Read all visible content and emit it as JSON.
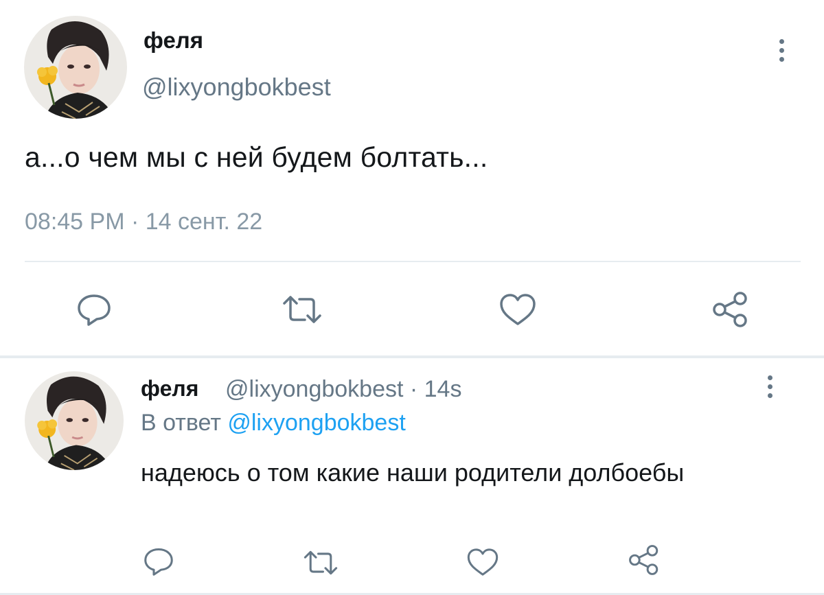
{
  "main_tweet": {
    "display_name": "феля",
    "handle": "@lixyongbokbest",
    "text": "а...о чем мы с ней будем болтать...",
    "timestamp": "08:45 PM · 14 сент. 22",
    "actions": [
      "reply-icon",
      "retweet-icon",
      "like-icon",
      "share-icon"
    ]
  },
  "reply_tweet": {
    "display_name": "феля",
    "handle_time": "@lixyongbokbest · 14s",
    "reply_prefix": "В ответ",
    "reply_to": "@lixyongbokbest",
    "text": "надеюсь о том какие наши родители долбоебы",
    "actions": [
      "reply-icon",
      "retweet-icon",
      "like-icon",
      "share-icon"
    ]
  },
  "colors": {
    "text": "#14171a",
    "secondary": "#657786",
    "link": "#1da1f2",
    "icon": "#657786",
    "divider": "#e6ecf0"
  }
}
